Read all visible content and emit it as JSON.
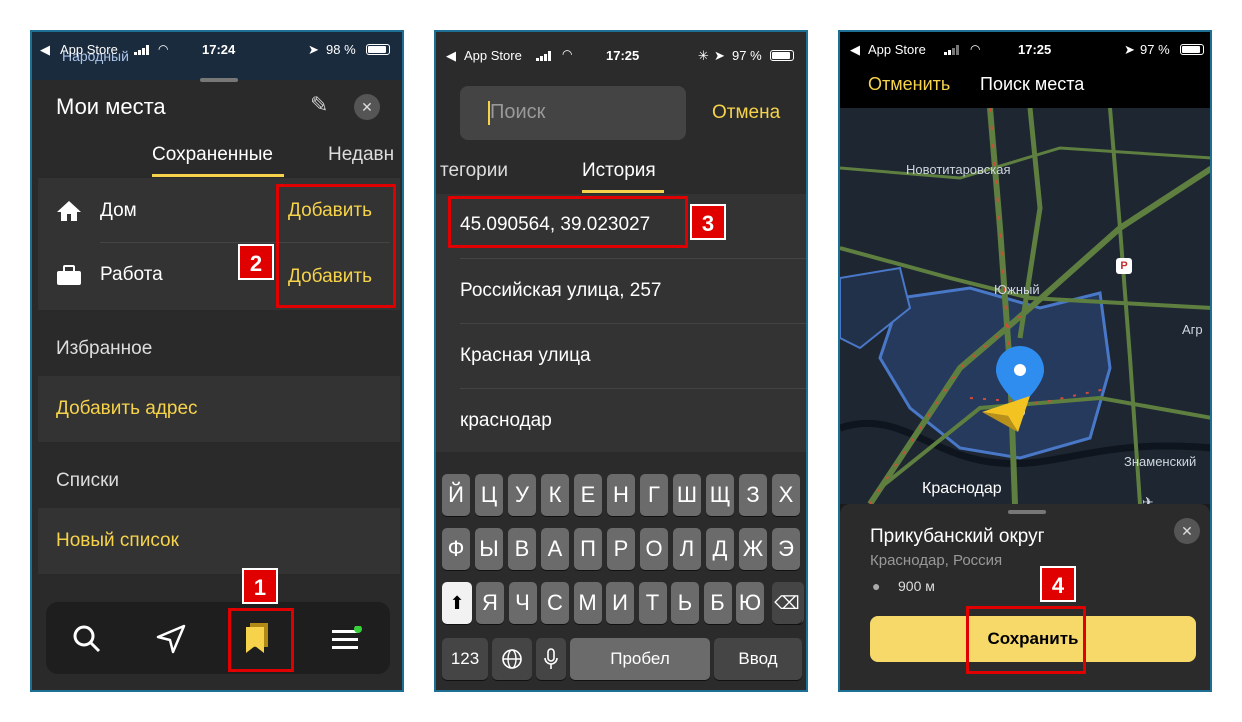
{
  "colors": {
    "accent": "#f6d34a",
    "marker": "#e00000",
    "panel": "#2a2a2a",
    "map_water": "#1c2430"
  },
  "screen1": {
    "status": {
      "carrier": "App Store",
      "time": "17:24",
      "battery": "98 %"
    },
    "map_hint": "Народный",
    "title": "Мои места",
    "tabs": [
      "Сохраненные",
      "Недавн"
    ],
    "home_label": "Дом",
    "work_label": "Работа",
    "add_label": "Добавить",
    "favorites_title": "Избранное",
    "add_address": "Добавить адрес",
    "lists_title": "Списки",
    "new_list": "Новый список",
    "badges": [
      "1",
      "2"
    ]
  },
  "screen2": {
    "status": {
      "carrier": "App Store",
      "time": "17:25",
      "battery": "97 %"
    },
    "search_placeholder": "Поиск",
    "cancel": "Отмена",
    "tabs": [
      "тегории",
      "История"
    ],
    "history": [
      "45.090564, 39.023027",
      "Российская улица, 257",
      "Красная улица",
      "краснодар"
    ],
    "badge": "3",
    "keyboard": {
      "row1": [
        "Й",
        "Ц",
        "У",
        "К",
        "Е",
        "Н",
        "Г",
        "Ш",
        "Щ",
        "З",
        "Х"
      ],
      "row2": [
        "Ф",
        "Ы",
        "В",
        "А",
        "П",
        "Р",
        "О",
        "Л",
        "Д",
        "Ж",
        "Э"
      ],
      "row3": [
        "Я",
        "Ч",
        "С",
        "М",
        "И",
        "Т",
        "Ь",
        "Б",
        "Ю"
      ],
      "num": "123",
      "space": "Пробел",
      "enter": "Ввод"
    }
  },
  "screen3": {
    "status": {
      "carrier": "App Store",
      "time": "17:25",
      "battery": "97 %"
    },
    "cancel": "Отменить",
    "title": "Поиск места",
    "map_labels": [
      "Новотитаровская",
      "Южный",
      "Агр",
      "Знаменский",
      "Краснодар"
    ],
    "place_title": "Прикубанский округ",
    "place_subtitle": "Краснодар, Россия",
    "distance": "900 м",
    "save": "Сохранить",
    "badge": "4"
  }
}
